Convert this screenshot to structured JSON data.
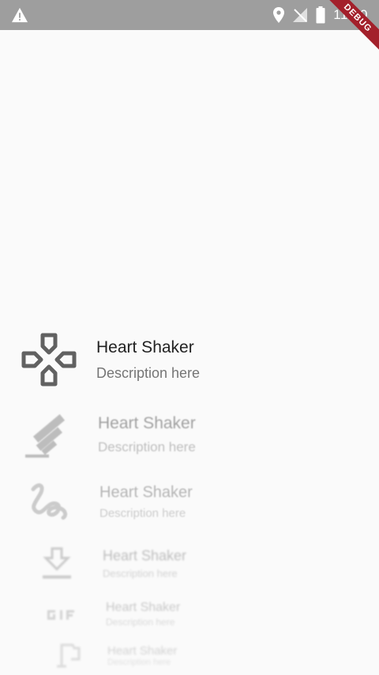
{
  "status_bar": {
    "time": "11:30",
    "icons": [
      "warning-icon",
      "location-icon",
      "no-signal-icon",
      "battery-icon"
    ],
    "background": "#9e9e9e"
  },
  "debug_banner": {
    "label": "DEBUG",
    "color": "#a3202b"
  },
  "list": {
    "items": [
      {
        "title": "Heart Shaker",
        "description": "Description here",
        "icon": "gamepad-icon"
      },
      {
        "title": "Heart Shaker",
        "description": "Description here",
        "icon": "satellite-icon"
      },
      {
        "title": "Heart Shaker",
        "description": "Description here",
        "icon": "gesture-icon"
      },
      {
        "title": "Heart Shaker",
        "description": "Description here",
        "icon": "download-icon"
      },
      {
        "title": "Heart Shaker",
        "description": "Description here",
        "icon": "gif-icon"
      },
      {
        "title": "Heart Shaker",
        "description": "Description here",
        "icon": "flag-icon"
      }
    ]
  }
}
